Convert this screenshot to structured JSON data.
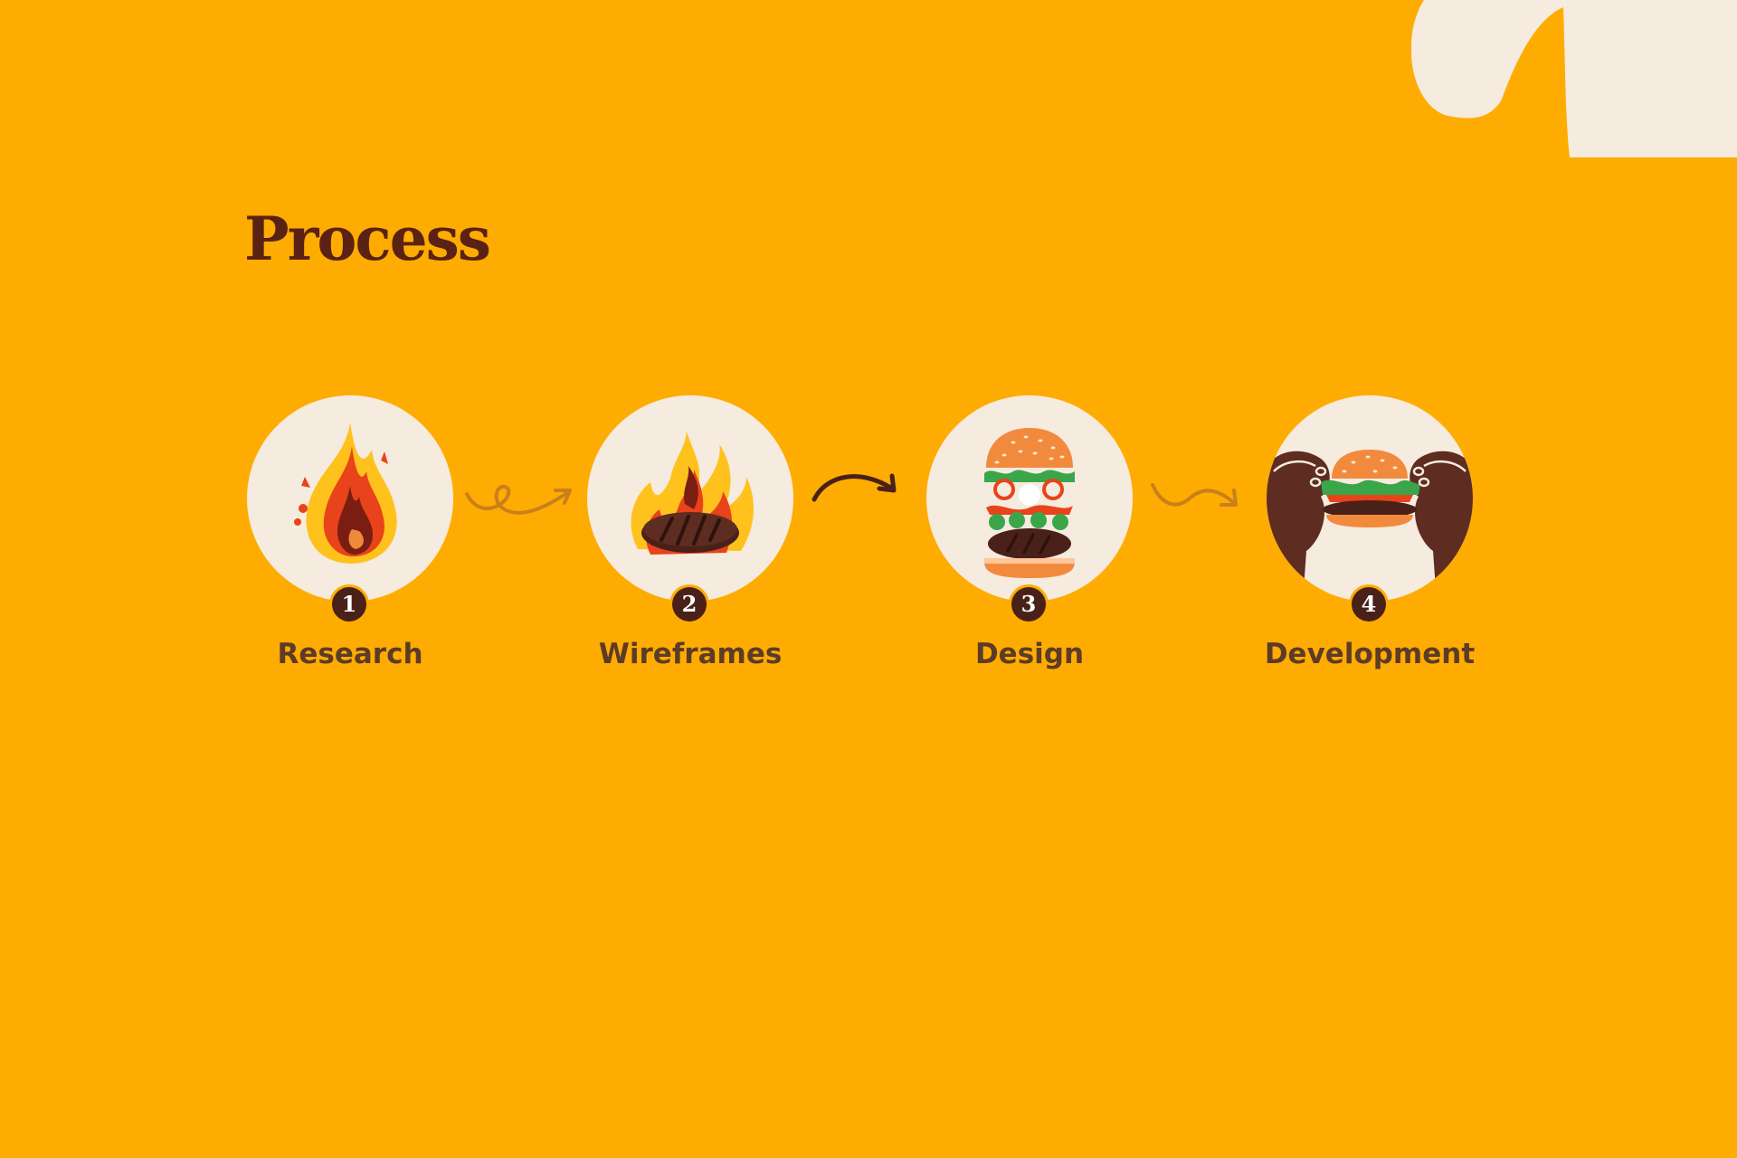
{
  "page": {
    "title": "Process",
    "background_color": "#FFAC02"
  },
  "steps": [
    {
      "number": "1",
      "label": "Research",
      "icon": "fire-icon"
    },
    {
      "number": "2",
      "label": "Wireframes",
      "icon": "grilled-patty-icon"
    },
    {
      "number": "3",
      "label": "Design",
      "icon": "stacked-burger-icon"
    },
    {
      "number": "4",
      "label": "Development",
      "icon": "hands-holding-burger-icon"
    }
  ],
  "colors": {
    "circle": "#F5EBDE",
    "title": "#5A2214",
    "number_badge": "#4A2118",
    "label": "#5C3B27",
    "arrow_light": "#C9801A",
    "arrow_dark": "#4A2118"
  }
}
